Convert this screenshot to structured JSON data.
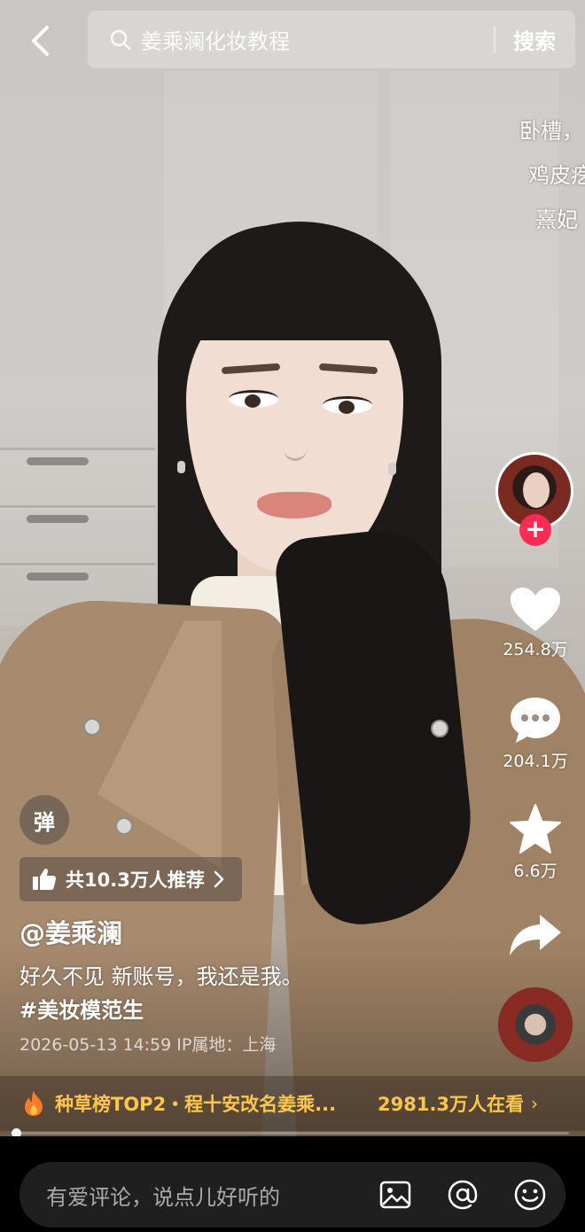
{
  "search": {
    "query": "姜乘澜化妆教程",
    "button_label": "搜索"
  },
  "danmaku": [
    "卧槽，",
    "鸡皮疙",
    "熹妃"
  ],
  "rail": {
    "likes": "254.8万",
    "comments": "204.1万",
    "favorites": "6.6万",
    "follow_symbol": "+"
  },
  "info": {
    "danmu_toggle": "弹",
    "recommend": "共10.3万人推荐",
    "author": "@姜乘澜",
    "caption": "好久不见 新账号，我还是我。",
    "hashtag": "#美妆模范生",
    "meta": "2026-05-13 14:59  IP属地：上海"
  },
  "hot": {
    "title": "种草榜TOP2・程十安改名姜乘...",
    "viewers": "2981.3万人在看",
    "chevron": "›"
  },
  "progress": {
    "percent": 0
  },
  "comment": {
    "placeholder": "有爱评论，说点儿好听的"
  },
  "colors": {
    "accent_red": "#fe2c55",
    "hot_gold": "#ffc64a"
  },
  "icons": [
    "back-icon",
    "search-icon",
    "heart-icon",
    "comment-icon",
    "star-icon",
    "share-icon",
    "thumbs-up-icon",
    "fire-icon",
    "image-icon",
    "at-icon",
    "emoji-icon"
  ]
}
